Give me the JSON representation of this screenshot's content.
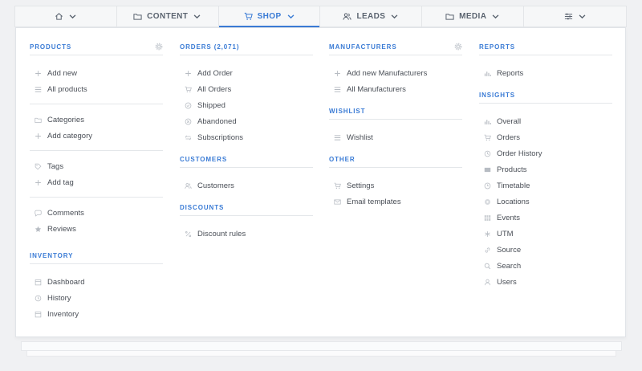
{
  "nav": [
    {
      "label": "",
      "icon": "home-icon",
      "active": false
    },
    {
      "label": "CONTENT",
      "icon": "folder-icon",
      "active": false
    },
    {
      "label": "SHOP",
      "icon": "cart-icon",
      "active": true
    },
    {
      "label": "LEADS",
      "icon": "users-icon",
      "active": false
    },
    {
      "label": "MEDIA",
      "icon": "folder-icon",
      "active": false
    },
    {
      "label": "",
      "icon": "sliders-icon",
      "active": false
    }
  ],
  "columns": {
    "col1": {
      "products": {
        "title": "PRODUCTS",
        "groups": [
          [
            {
              "label": "Add new",
              "icon": "plus-icon"
            },
            {
              "label": "All products",
              "icon": "list-icon"
            }
          ],
          [
            {
              "label": "Categories",
              "icon": "folder-icon"
            },
            {
              "label": "Add category",
              "icon": "plus-icon"
            }
          ],
          [
            {
              "label": "Tags",
              "icon": "tag-icon"
            },
            {
              "label": "Add tag",
              "icon": "plus-icon"
            }
          ],
          [
            {
              "label": "Comments",
              "icon": "comment-icon"
            },
            {
              "label": "Reviews",
              "icon": "star-icon"
            }
          ]
        ]
      },
      "inventory": {
        "title": "INVENTORY",
        "items": [
          {
            "label": "Dashboard",
            "icon": "calendar-icon"
          },
          {
            "label": "History",
            "icon": "history-icon"
          },
          {
            "label": "Inventory",
            "icon": "calendar-icon"
          }
        ]
      }
    },
    "col2": {
      "orders": {
        "title": "ORDERS (2,071)",
        "items": [
          {
            "label": "Add Order",
            "icon": "plus-icon"
          },
          {
            "label": "All Orders",
            "icon": "cart-icon"
          },
          {
            "label": "Shipped",
            "icon": "check-circle-icon"
          },
          {
            "label": "Abandoned",
            "icon": "x-circle-icon"
          },
          {
            "label": "Subscriptions",
            "icon": "repeat-icon"
          }
        ]
      },
      "customers": {
        "title": "CUSTOMERS",
        "items": [
          {
            "label": "Customers",
            "icon": "users-icon"
          }
        ]
      },
      "discounts": {
        "title": "DISCOUNTS",
        "items": [
          {
            "label": "Discount rules",
            "icon": "percent-icon"
          }
        ]
      }
    },
    "col3": {
      "manufacturers": {
        "title": "MANUFACTURERS",
        "items": [
          {
            "label": "Add new Manufacturers",
            "icon": "plus-icon"
          },
          {
            "label": "All Manufacturers",
            "icon": "list-icon"
          }
        ]
      },
      "wishlist": {
        "title": "WISHLIST",
        "items": [
          {
            "label": "Wishlist",
            "icon": "list-icon"
          }
        ]
      },
      "other": {
        "title": "OTHER",
        "items": [
          {
            "label": "Settings",
            "icon": "cart-icon"
          },
          {
            "label": "Email templates",
            "icon": "mail-icon"
          }
        ]
      }
    },
    "col4": {
      "reports": {
        "title": "REPORTS",
        "items": [
          {
            "label": "Reports",
            "icon": "bar-chart-icon"
          }
        ]
      },
      "insights": {
        "title": "INSIGHTS",
        "items": [
          {
            "label": "Overall",
            "icon": "bar-chart-icon"
          },
          {
            "label": "Orders",
            "icon": "cart-icon"
          },
          {
            "label": "Order History",
            "icon": "history-icon"
          },
          {
            "label": "Products",
            "icon": "box-icon"
          },
          {
            "label": "Timetable",
            "icon": "clock-icon"
          },
          {
            "label": "Locations",
            "icon": "pin-icon"
          },
          {
            "label": "Events",
            "icon": "grid-icon"
          },
          {
            "label": "UTM",
            "icon": "asterisk-icon"
          },
          {
            "label": "Source",
            "icon": "link-icon"
          },
          {
            "label": "Search",
            "icon": "search-icon"
          },
          {
            "label": "Users",
            "icon": "user-icon"
          }
        ]
      }
    }
  },
  "colors": {
    "accent": "#3a7bd5",
    "icon": "#b7bcc3",
    "text": "#4a4f57"
  }
}
